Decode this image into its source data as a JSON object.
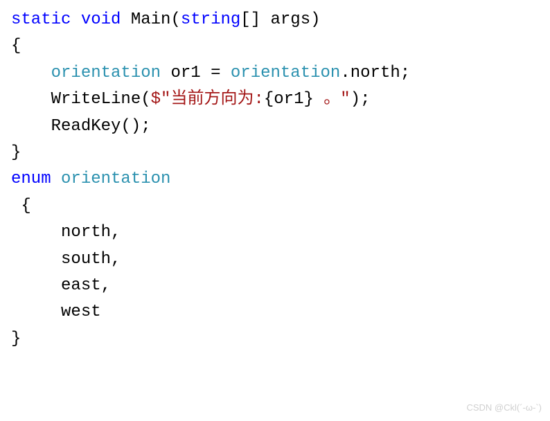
{
  "tokens": {
    "static": "static",
    "void": "void",
    "main": "Main",
    "string": "string",
    "args": "args",
    "orientation_type": "orientation",
    "or1": "or1",
    "eq": " = ",
    "orientation_ref": "orientation",
    "dot_north": ".north;",
    "writeline": "WriteLine",
    "dollar": "$",
    "str1": "\"当前方向为:",
    "interp_open": "{or1}",
    "str2": " 。\"",
    "readkey": "ReadKey",
    "enum": "enum",
    "orientation_decl": "orientation",
    "north": "north,",
    "south": "south,",
    "east": "east,",
    "west": "west"
  },
  "indent": {
    "one": "    ",
    "oneplus": "     "
  },
  "braces": {
    "open": "{",
    "close": "}",
    "open_space": " {"
  },
  "punct": {
    "lparen": "(",
    "rparen": ")",
    "lbracket": "[",
    "rbracket": "]",
    "space": " ",
    "rparen_semi": ");",
    "empty_call": "();"
  },
  "watermark": "CSDN @Ckl(´-ω-`)"
}
